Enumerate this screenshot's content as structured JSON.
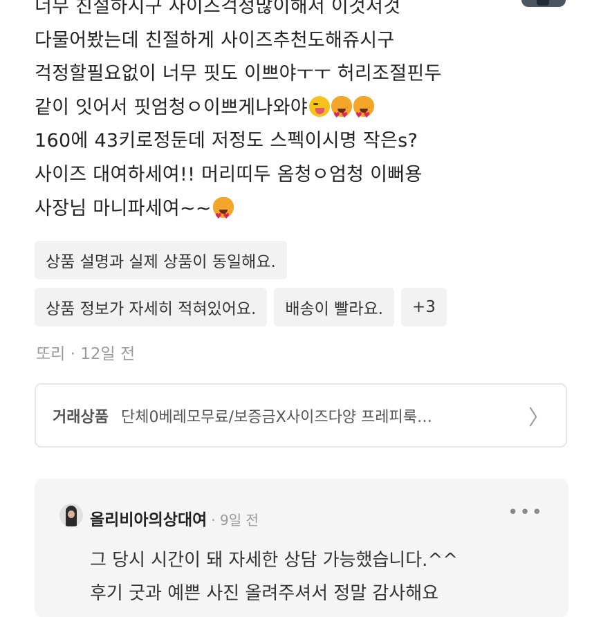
{
  "review": {
    "lines": [
      "너무 친절하시구 사이즈걱정많이해서 이것저것",
      "다물어봤는데 친절하게 사이즈추천도해쥬시구",
      "걱정할필요없이 너무 핏도 이쁘야ㅜㅜ 허리조절핀두",
      "같이 잇어서 핏엄청ㅇ이쁘게나와야",
      "160에 43키로정둔데 저정도 스펙이시명 작은s?",
      "사이즈 대여하세여!! 머리띠두 옴청ㅇ엄청 이뻐용",
      "사장님 마니파세여~~"
    ]
  },
  "tags": {
    "row1": [
      "상품 설명과 실제 상품이 동일해요."
    ],
    "row2": [
      "상품 정보가 자세히 적혀있어요.",
      "배송이 빨라요.",
      "+3"
    ]
  },
  "meta": {
    "author": "또리",
    "time": " · 12일 전"
  },
  "product": {
    "label": "거래상품",
    "name": "단체0베레모무료/보증금X사이즈다양 프레피룩…"
  },
  "reply": {
    "seller_name": "올리비아의상대여",
    "time": "· 9일 전",
    "more_icon": "more-dots-icon",
    "lines": [
      "그 당시 시간이 돼 자세한 상담 가능했습니다.^^",
      "후기 굿과 예쁜 사진 올려주셔서 정말 감사해요"
    ]
  },
  "icons": {
    "emojis": [
      "face-savoring-icon",
      "heart-eyes-cat-icon",
      "heart-eyes-cat-icon",
      "heart-eyes-cat-icon"
    ],
    "chevron": "chevron-right-icon"
  }
}
